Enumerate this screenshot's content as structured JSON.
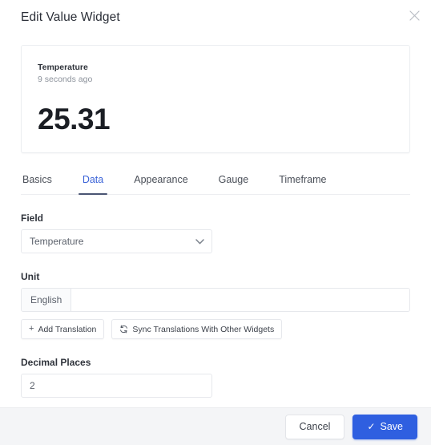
{
  "dialog": {
    "title": "Edit Value Widget",
    "close_icon": "close-icon"
  },
  "preview": {
    "title": "Temperature",
    "timestamp": "9 seconds ago",
    "value": "25.31"
  },
  "tabs": [
    {
      "label": "Basics",
      "active": false
    },
    {
      "label": "Data",
      "active": true
    },
    {
      "label": "Appearance",
      "active": false
    },
    {
      "label": "Gauge",
      "active": false
    },
    {
      "label": "Timeframe",
      "active": false
    }
  ],
  "form": {
    "field": {
      "label": "Field",
      "value": "Temperature",
      "chevron_icon": "chevron-down-icon"
    },
    "unit": {
      "label": "Unit",
      "language_addon": "English",
      "value": "",
      "placeholder": ""
    },
    "translation_buttons": {
      "add": {
        "label": "Add Translation",
        "icon": "plus-icon",
        "glyph": "+"
      },
      "sync": {
        "label": "Sync Translations With Other Widgets",
        "icon": "sync-icon",
        "glyph": "↻"
      }
    },
    "decimal_places": {
      "label": "Decimal Places",
      "value": "2"
    }
  },
  "footer": {
    "cancel_label": "Cancel",
    "save_label": "Save",
    "save_icon": "check-icon",
    "save_glyph": "✓"
  },
  "colors": {
    "accent_blue": "#2f5fe0",
    "tab_active": "#3a63d8",
    "footer_bg": "#f4f5f7",
    "border": "#e6e8ec"
  }
}
